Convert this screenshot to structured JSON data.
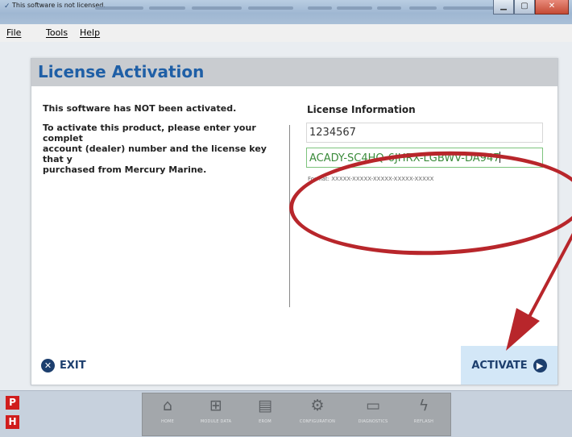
{
  "window": {
    "title": "This software is not licensed."
  },
  "menu": {
    "items": [
      "File",
      "Tools",
      "Help"
    ]
  },
  "dialog": {
    "title": "License Activation",
    "status_text": "This software has NOT been activated.",
    "instruction_line1": "To activate this product, please enter your complet",
    "instruction_line2": "account (dealer) number and the license key that y",
    "instruction_line3": "purchased from Mercury Marine.",
    "license_heading": "License Information",
    "account_value": "1234567",
    "license_key_value": "ACADY-SC4HQ-6JHRX-LGBWV-DA947",
    "format_hint": "Format: XXXXX-XXXXX-XXXXX-XXXXX-XXXXX",
    "exit_label": "EXIT",
    "activate_label": "ACTIVATE"
  },
  "taskbar": {
    "left_badges": [
      "P",
      "H"
    ],
    "nav_items": [
      {
        "label": "HOME",
        "icon": "home-icon"
      },
      {
        "label": "MODULE DATA",
        "icon": "module-data-icon"
      },
      {
        "label": "EROM",
        "icon": "erom-icon"
      },
      {
        "label": "CONFIGURATION",
        "icon": "configuration-icon"
      },
      {
        "label": "DIAGNOSTICS",
        "icon": "diagnostics-icon"
      },
      {
        "label": "REFLASH",
        "icon": "reflash-icon"
      }
    ]
  },
  "colors": {
    "title_blue": "#1f5fa6",
    "annotation_red": "#b8262b",
    "key_green": "#3b8b3b",
    "activate_bg": "#d3e7f7"
  }
}
